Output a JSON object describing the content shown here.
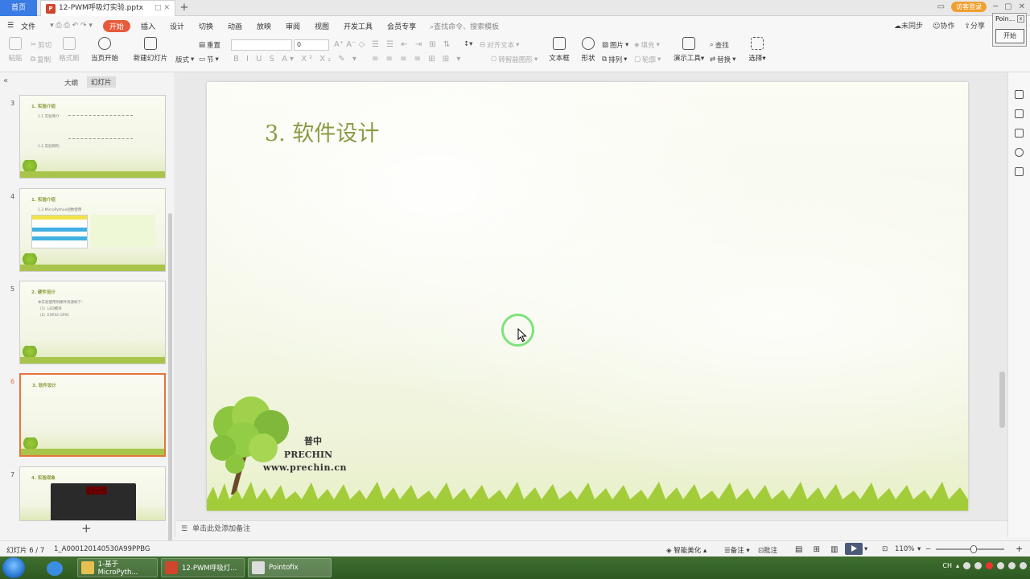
{
  "titlebar": {
    "home_tab": "首页",
    "doc_tab": "12-PWM呼吸灯实验.pptx",
    "new_tab": "+",
    "login": "访客登录"
  },
  "menu": {
    "file": "文件",
    "start": "开始",
    "items": [
      "插入",
      "设计",
      "切换",
      "动画",
      "放映",
      "审阅",
      "视图",
      "开发工具",
      "会员专享"
    ],
    "search": "查找命令、搜索模板",
    "right": [
      "未同步",
      "协作",
      "分享"
    ]
  },
  "ribbon": {
    "paste": "粘贴",
    "cut": "剪切",
    "copy": "复制",
    "format_painter": "格式刷",
    "play_from_current": "当页开始",
    "new_slide": "新建幻灯片",
    "layout": "版式",
    "section": "节",
    "reset": "重置",
    "font_size": "0",
    "align_text": "对齐文本",
    "smart_art": "转智能图形",
    "textbox": "文本框",
    "shape": "形状",
    "picture": "图片",
    "fill": "填充",
    "arrange": "排列",
    "outline": "轮廓",
    "presenter_tools": "演示工具",
    "find": "查找",
    "replace": "替换",
    "select": "选择"
  },
  "pointofix": {
    "title": "Poin...",
    "start": "开始"
  },
  "left_pane": {
    "tab_outline": "大纲",
    "tab_slides": "幻灯片",
    "thumbnails": [
      {
        "num": "3",
        "title": "1. 实验介绍",
        "lines": [
          "1.1 实验简介",
          "1.2 实验目的"
        ]
      },
      {
        "num": "4",
        "title": "1. 实验介绍",
        "lines": [
          "1.3 MicroPython函数使用"
        ]
      },
      {
        "num": "5",
        "title": "2. 硬件设计",
        "lines": [
          "本实验使用到硬件资源如下：",
          "（1）LED模块",
          "（2）ESP32 GPIO"
        ]
      },
      {
        "num": "6",
        "title": "3. 软件设计",
        "lines": []
      },
      {
        "num": "7",
        "title": "4. 实验现象",
        "lines": []
      }
    ]
  },
  "slide": {
    "title": "3. 软件设计",
    "brand_cn": "普中",
    "brand_en": "PRECHIN",
    "brand_url": "www.prechin.cn"
  },
  "notes": {
    "placeholder": "单击此处添加备注"
  },
  "status": {
    "slide_counter": "幻灯片 6 / 7",
    "template_id": "1_A000120140530A99PPBG",
    "beautify": "智能美化",
    "notes": "备注",
    "comments": "批注",
    "zoom": "110%"
  },
  "taskbar": {
    "items": [
      "1-基于MicroPyth...",
      "12-PWM呼吸灯...",
      "Pointofix"
    ],
    "tray_text": "CH"
  },
  "colors": {
    "accent": "#3a7be5",
    "start_menu": "#e85a3a",
    "slide_title": "#8c9a42",
    "selected_thumb": "#e8733a"
  }
}
